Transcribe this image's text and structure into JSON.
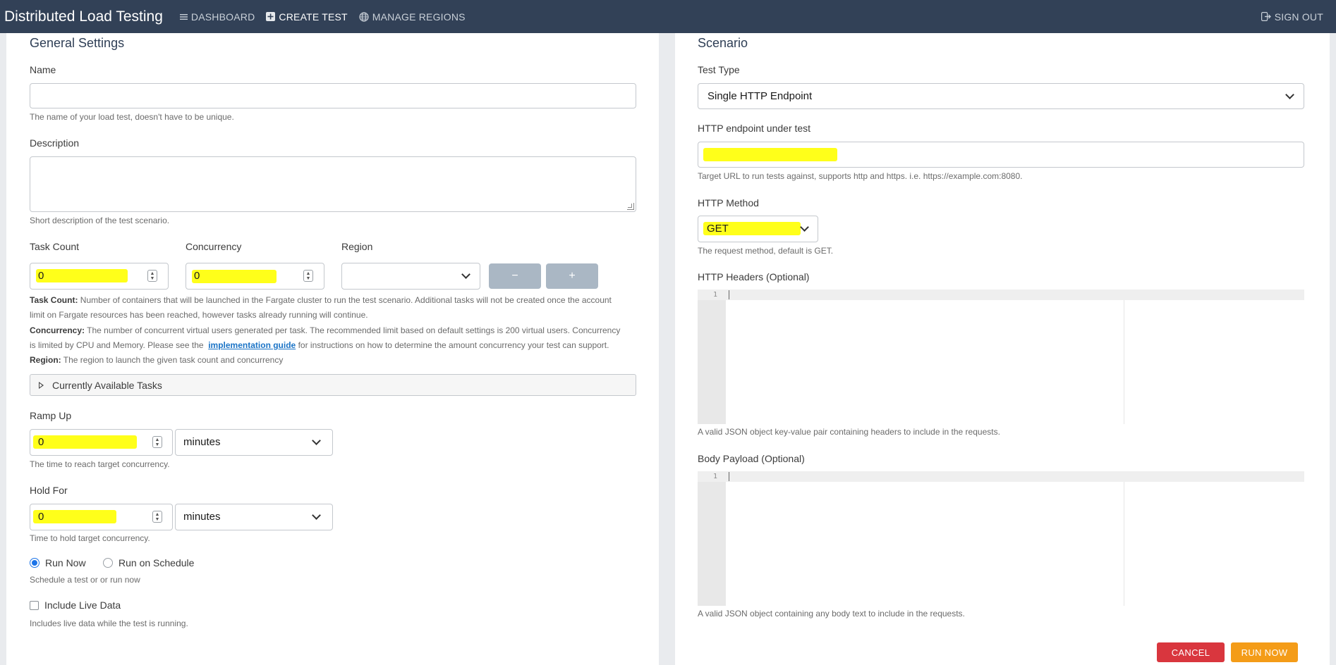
{
  "navbar": {
    "brand": "Distributed Load Testing",
    "links": [
      {
        "label": "DASHBOARD",
        "icon": "list-icon"
      },
      {
        "label": "CREATE TEST",
        "icon": "plus-square-icon"
      },
      {
        "label": "MANAGE REGIONS",
        "icon": "globe-icon"
      }
    ],
    "sign_out": {
      "label": "SIGN OUT",
      "icon": "sign-out-icon"
    }
  },
  "general": {
    "title": "General Settings",
    "name": {
      "label": "Name",
      "value": "",
      "help": "The name of your load test, doesn't have to be unique."
    },
    "description": {
      "label": "Description",
      "value": "",
      "help": "Short description of the test scenario."
    },
    "task_count": {
      "label": "Task Count",
      "value": "0"
    },
    "concurrency": {
      "label": "Concurrency",
      "value": "0"
    },
    "region": {
      "label": "Region",
      "value": ""
    },
    "minus_label": "−",
    "plus_label": "+",
    "help_task_bold": "Task Count:",
    "help_task_1": "Number of containers that will be launched in the Fargate cluster to run the test scenario. Additional tasks will not be created once the account",
    "help_task_2": "limit on Fargate resources has been reached, however tasks already running will continue.",
    "help_conc_bold": "Concurrency:",
    "help_conc_1": "The number of concurrent virtual users generated per task. The recommended limit based on default settings is 200 virtual users. Concurrency",
    "help_conc_2a": "is limited by CPU and Memory. Please see the",
    "help_conc_link": "implementation guide",
    "help_conc_2b": "for instructions on how to determine the amount concurrency your test can support.",
    "help_region_bold": "Region:",
    "help_region": "The region to launch the given task count and concurrency",
    "available_tasks": "Currently Available Tasks",
    "ramp_up": {
      "label": "Ramp Up",
      "value": "0",
      "unit": "minutes",
      "help": "The time to reach target concurrency."
    },
    "hold_for": {
      "label": "Hold For",
      "value": "0",
      "unit": "minutes",
      "help": "Time to hold target concurrency."
    },
    "schedule": {
      "run_now": "Run Now",
      "run_on_schedule": "Run on Schedule",
      "selected": "Run Now",
      "help": "Schedule a test or or run now"
    },
    "live_data": {
      "label": "Include Live Data",
      "checked": false,
      "help": "Includes live data while the test is running."
    }
  },
  "scenario": {
    "title": "Scenario",
    "test_type": {
      "label": "Test Type",
      "value": "Single HTTP Endpoint"
    },
    "endpoint": {
      "label": "HTTP endpoint under test",
      "value": "",
      "help": "Target URL to run tests against, supports http and https. i.e. https://example.com:8080."
    },
    "method": {
      "label": "HTTP Method",
      "value": "GET",
      "help": "The request method, default is GET."
    },
    "headers": {
      "label": "HTTP Headers (Optional)",
      "line": "1",
      "help": "A valid JSON object key-value pair containing headers to include in the requests."
    },
    "body": {
      "label": "Body Payload (Optional)",
      "line": "1",
      "help": "A valid JSON object containing any body text to include in the requests."
    }
  },
  "actions": {
    "cancel": "CANCEL",
    "run_now": "RUN NOW"
  },
  "colors": {
    "navbar": "#324157",
    "highlight": "#ffff1a",
    "cancel": "#d9363e",
    "run": "#f49c18",
    "radio_selected": "#1a73e8"
  }
}
